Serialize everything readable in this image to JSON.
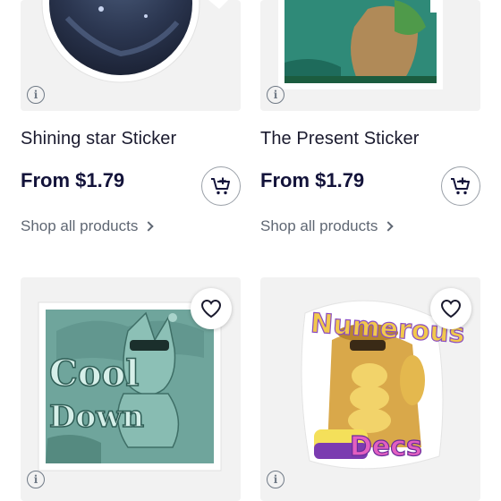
{
  "products": [
    {
      "title": "Shining star Sticker",
      "price": "From $1.79",
      "shop_link": "Shop all products",
      "image": "round-dark-planet-sticker-image"
    },
    {
      "title": "The Present Sticker",
      "price": "From $1.79",
      "shop_link": "Shop all products",
      "image": "green-square-art-sticker-image"
    },
    {
      "sticker_text_1": "Cool",
      "sticker_text_2": "Down",
      "image": "teal-cool-down-sticker-image"
    },
    {
      "sticker_text_1": "Numerous",
      "sticker_text_2": "Decs",
      "image": "numerous-decs-sticker-image"
    }
  ],
  "icons": {
    "info": "info-icon",
    "favorite": "heart-icon",
    "add_to_cart": "cart-plus-icon",
    "shop_chevron": "chevron-right-icon"
  },
  "colors": {
    "price": "#13133a",
    "link": "#5f6773",
    "card_bg": "#f2f2f2"
  }
}
